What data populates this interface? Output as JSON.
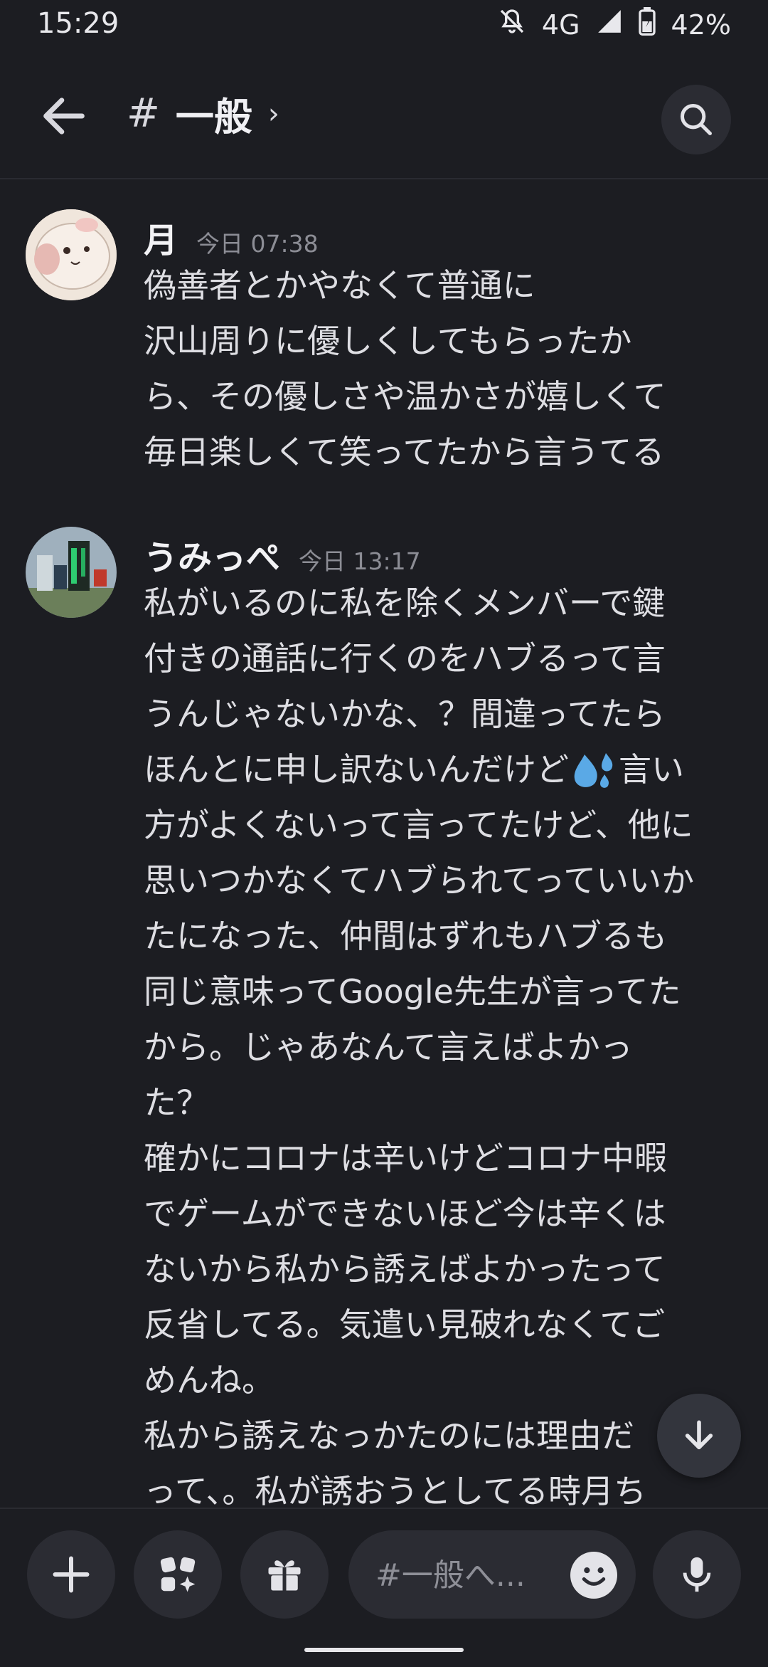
{
  "status_bar": {
    "time": "15:29",
    "network": "4G",
    "battery": "42%"
  },
  "header": {
    "channel": "一般",
    "hash": "#",
    "chevron": "›"
  },
  "messages": [
    {
      "author": "月",
      "timestamp": "今日 07:38",
      "lines": [
        "偽善者とかやなくて普通に",
        "沢山周りに優しくしてもらったか",
        "ら、その優しさや温かさが嬉しくて",
        "毎日楽しくて笑ってたから言うてる"
      ]
    },
    {
      "author": "うみっぺ",
      "timestamp": "今日 13:17",
      "lines": [
        "私がいるのに私を除くメンバーで鍵",
        "付きの通話に行くのをハブるって言",
        "うんじゃないかな、？間違ってたら",
        "ほんとに申し訳ないんだけど",
        "方がよくないって言ってたけど、他に",
        "思いつかなくてハブられてっていいか",
        "たになった、仲間はずれもハブるも",
        "同じ意味ってGoogle先生が言ってた",
        "から。じゃあなんて言えばよかっ",
        "た？",
        "確かにコロナは辛いけどコロナ中暇",
        "でゲームができないほど今は辛くは",
        "ないから私から誘えばよかったって",
        "反省してる。気遣い見破れなくてご",
        "めんね。",
        "私から誘えなっかたのには理由だ",
        "って、。私が誘おうとしてる時月ち"
      ],
      "line4_suffix": "言い"
    }
  ],
  "composer": {
    "placeholder": "#一般へ..."
  },
  "colors": {
    "background": "#1c1d22",
    "surface": "#2b2c33",
    "text": "#dedee3",
    "muted": "#8c8d95",
    "sweat_emoji": "#5aa9e6"
  },
  "icons": [
    "back-arrow-icon",
    "search-icon",
    "plus-icon",
    "apps-icon",
    "gift-icon",
    "emoji-icon",
    "microphone-icon",
    "arrow-down-icon",
    "mute-bell-icon",
    "signal-icon",
    "battery-icon",
    "sweat-droplets-icon"
  ]
}
